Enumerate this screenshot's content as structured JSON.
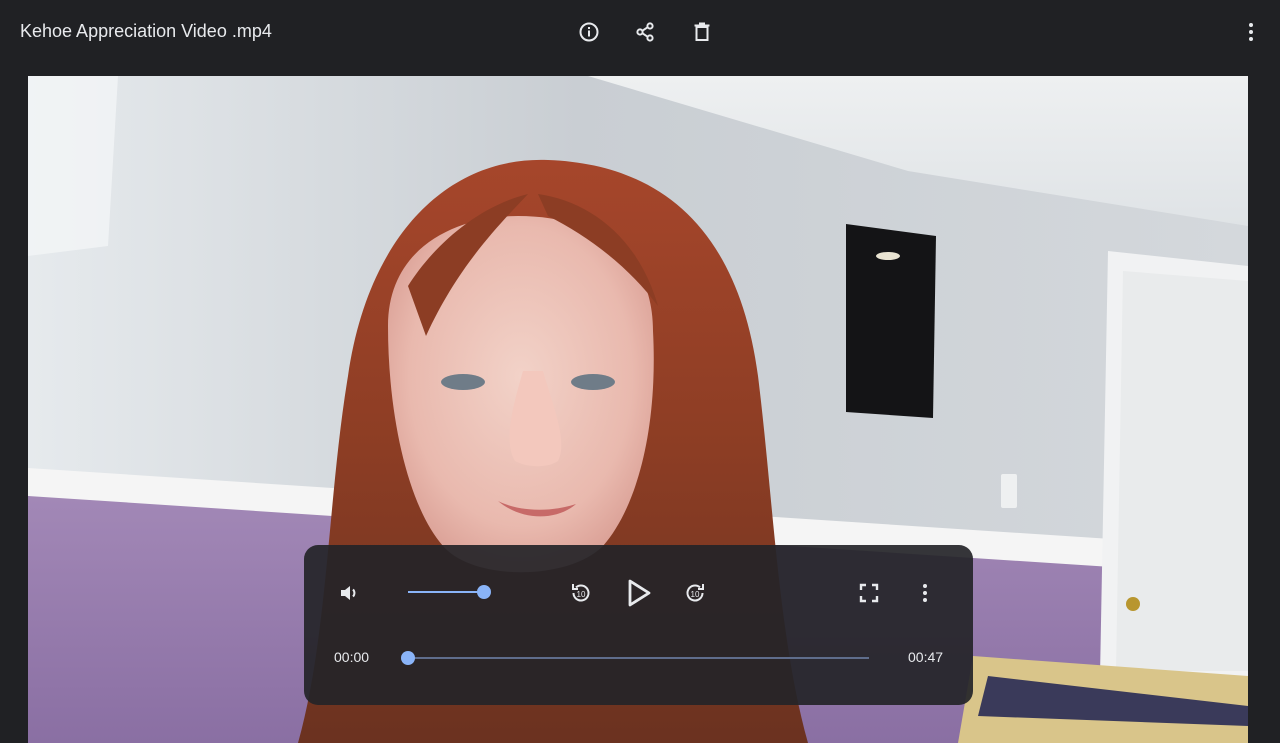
{
  "window": {
    "title": "Kehoe Appreciation Video .mp4",
    "actions": [
      {
        "name": "info",
        "icon": "info-icon"
      },
      {
        "name": "share",
        "icon": "share-icon"
      },
      {
        "name": "delete",
        "icon": "delete-icon"
      },
      {
        "name": "more",
        "icon": "more-vert-icon"
      }
    ]
  },
  "player": {
    "current_time": "00:00",
    "duration": "00:47",
    "volume_level": 1.0,
    "progress": 0.0,
    "state": "paused",
    "controls": [
      "volume-icon",
      "replay-10-icon",
      "play-icon",
      "forward-10-icon",
      "fullscreen-icon",
      "more-vert-icon"
    ],
    "accent_color": "#8ab4f8"
  }
}
